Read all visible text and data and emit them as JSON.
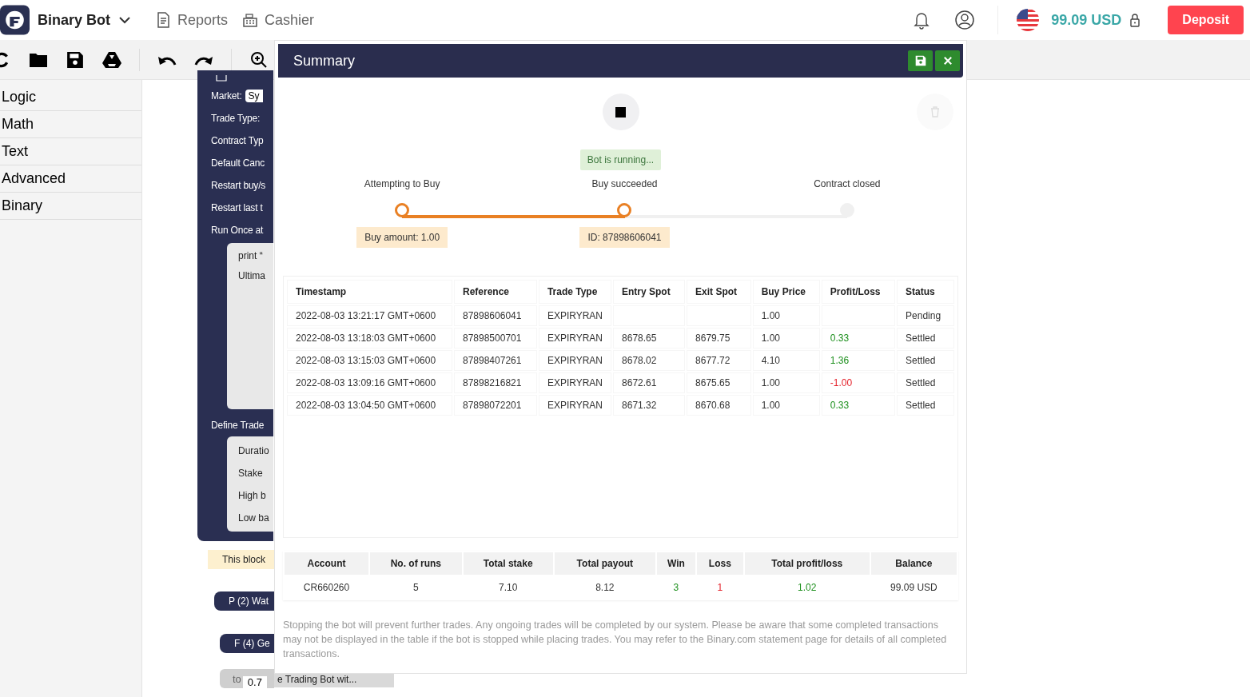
{
  "header": {
    "app_name": "Binary Bot",
    "nav": [
      {
        "label": "Reports",
        "kind": "reports"
      },
      {
        "label": "Cashier",
        "kind": "cashier"
      }
    ],
    "balance": "99.09 USD",
    "deposit": "Deposit"
  },
  "sidebar": {
    "items": [
      "Logic",
      "Math",
      "Text",
      "Advanced",
      "Binary"
    ]
  },
  "workspace": {
    "main_block": {
      "rows": [
        "Market:",
        "Trade Type:",
        "Contract Typ",
        "Default Canc",
        "Restart buy/s",
        "Restart last t",
        "Run Once at"
      ],
      "market_value": "Sy",
      "inner_rows": [
        "print “",
        "Ultima"
      ],
      "define_label": "Define Trade",
      "define_rows": [
        "Duratio",
        "Stake",
        "High b",
        "Low ba"
      ]
    },
    "comment": "This block",
    "pills": [
      "P (2) Wat",
      "F (4) Ge"
    ],
    "to_block": {
      "label": "to",
      "value": "0.7"
    },
    "tab_label": "e Trading Bot wit..."
  },
  "summary": {
    "title": "Summary",
    "status": "Bot is running...",
    "steps": [
      {
        "label": "Attempting to Buy",
        "done": true,
        "tip": "Buy amount: 1.00"
      },
      {
        "label": "Buy succeeded",
        "done": true,
        "tip": "ID: 87898606041"
      },
      {
        "label": "Contract closed",
        "done": false
      }
    ],
    "table": {
      "columns": [
        "Timestamp",
        "Reference",
        "Trade Type",
        "Entry Spot",
        "Exit Spot",
        "Buy Price",
        "Profit/Loss",
        "Status"
      ],
      "rows": [
        {
          "timestamp": "2022-08-03 13:21:17 GMT+0600",
          "reference": "87898606041",
          "trade_type": "EXPIRYRAN",
          "buy_price": "1.00",
          "status": "Pending"
        },
        {
          "timestamp": "2022-08-03 13:18:03 GMT+0600",
          "reference": "87898500701",
          "trade_type": "EXPIRYRAN",
          "entry_spot": "8678.65",
          "exit_spot": "8679.75",
          "buy_price": "1.00",
          "profit_loss": "0.33",
          "color": "#1c8f1c",
          "status": "Settled"
        },
        {
          "timestamp": "2022-08-03 13:15:03 GMT+0600",
          "reference": "87898407261",
          "trade_type": "EXPIRYRAN",
          "entry_spot": "8678.02",
          "exit_spot": "8677.72",
          "buy_price": "4.10",
          "profit_loss": "1.36",
          "color": "#1c8f1c",
          "status": "Settled"
        },
        {
          "timestamp": "2022-08-03 13:09:16 GMT+0600",
          "reference": "87898216821",
          "trade_type": "EXPIRYRAN",
          "entry_spot": "8672.61",
          "exit_spot": "8675.65",
          "buy_price": "1.00",
          "profit_loss": "-1.00",
          "color": "#e4212a",
          "status": "Settled"
        },
        {
          "timestamp": "2022-08-03 13:04:50 GMT+0600",
          "reference": "87898072201",
          "trade_type": "EXPIRYRAN",
          "entry_spot": "8671.32",
          "exit_spot": "8670.68",
          "buy_price": "1.00",
          "profit_loss": "0.33",
          "color": "#1c8f1c",
          "status": "Settled"
        }
      ]
    },
    "totals": {
      "columns": [
        "Account",
        "No. of runs",
        "Total stake",
        "Total payout",
        "Win",
        "Loss",
        "Total profit/loss",
        "Balance"
      ],
      "values": [
        {
          "text": "CR660260"
        },
        {
          "text": "5"
        },
        {
          "text": "7.10"
        },
        {
          "text": "8.12"
        },
        {
          "text": "3",
          "color": "#1c8f1c"
        },
        {
          "text": "1",
          "color": "#e4212a"
        },
        {
          "text": "1.02",
          "color": "#1c8f1c"
        },
        {
          "text": "99.09 USD"
        }
      ]
    },
    "note": "Stopping the bot will prevent further trades. Any ongoing trades will be completed by our system. Please be aware that some completed transactions may not be displayed in the table if the bot is stopped while placing trades. You may refer to the Binary.com statement page for details of all completed transactions."
  }
}
